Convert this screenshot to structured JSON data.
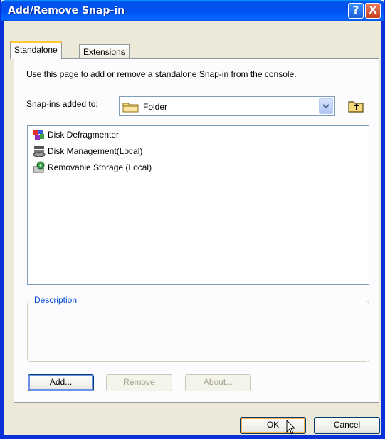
{
  "window": {
    "title": "Add/Remove Snap-in",
    "help_glyph": "?",
    "close_glyph": "X"
  },
  "tabs": [
    {
      "label": "Standalone",
      "active": true
    },
    {
      "label": "Extensions",
      "active": false
    }
  ],
  "intro_text": "Use this page to add or remove a standalone Snap-in from the console.",
  "snapins_label": "Snap-ins added to:",
  "snapins_combo": {
    "value": "Folder",
    "icon": "folder-icon"
  },
  "snapins_list": [
    {
      "label": "Disk Defragmenter",
      "icon": "disk-defragmenter-icon"
    },
    {
      "label": "Disk Management(Local)",
      "icon": "disk-management-icon"
    },
    {
      "label": "Removable Storage (Local)",
      "icon": "removable-storage-icon"
    }
  ],
  "description_label": "Description",
  "buttons": {
    "add": "Add...",
    "remove": "Remove",
    "about": "About...",
    "ok": "OK",
    "cancel": "Cancel"
  },
  "colors": {
    "titlebar": "#0054e3",
    "accent": "#0046d5",
    "active_tab": "#ffc83c"
  }
}
